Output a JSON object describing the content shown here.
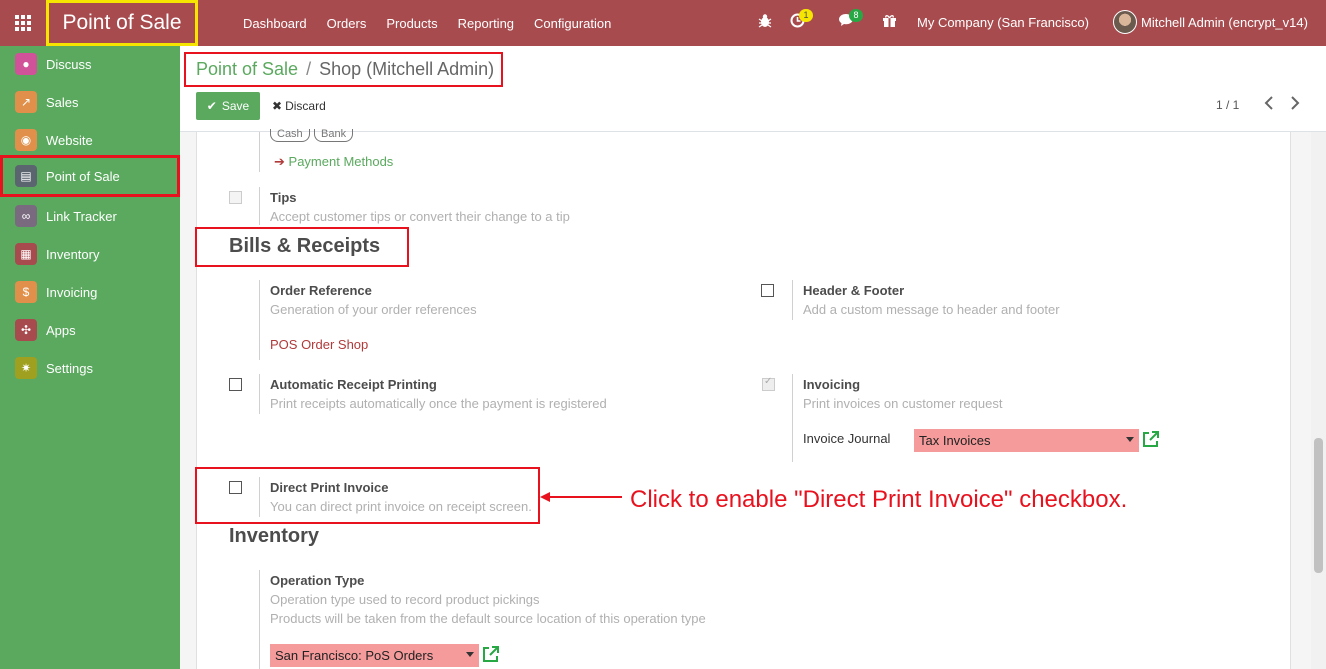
{
  "navbar": {
    "brand": "Point of Sale",
    "menu": [
      "Dashboard",
      "Orders",
      "Products",
      "Reporting",
      "Configuration"
    ],
    "activity_badge": "1",
    "messages_badge": "8",
    "company": "My Company (San Francisco)",
    "user": "Mitchell Admin (encrypt_v14)"
  },
  "sidebar": {
    "items": [
      {
        "label": "Discuss",
        "icon": "chat-bubble-icon",
        "color": "#d0539a"
      },
      {
        "label": "Sales",
        "icon": "chart-line-icon",
        "color": "#e0904a"
      },
      {
        "label": "Website",
        "icon": "globe-icon",
        "color": "#e0904a"
      },
      {
        "label": "Point of Sale",
        "icon": "store-icon",
        "color": "#5b6570"
      },
      {
        "label": "Link Tracker",
        "icon": "link-icon",
        "color": "#7a6a80"
      },
      {
        "label": "Inventory",
        "icon": "boxes-icon",
        "color": "#a74b4f"
      },
      {
        "label": "Invoicing",
        "icon": "invoice-icon",
        "color": "#e0904a"
      },
      {
        "label": "Apps",
        "icon": "puzzle-icon",
        "color": "#a74b4f"
      },
      {
        "label": "Settings",
        "icon": "gear-icon",
        "color": "#a0a020"
      }
    ]
  },
  "breadcrumb": {
    "parent": "Point of Sale",
    "separator": "/",
    "current": "Shop (Mitchell Admin)"
  },
  "toolbar": {
    "save_label": "Save",
    "discard_label": "Discard",
    "pager": "1 / 1"
  },
  "payments": {
    "tags": [
      "Cash",
      "Bank"
    ],
    "payment_methods_link": "Payment Methods"
  },
  "tips": {
    "title": "Tips",
    "description": "Accept customer tips or convert their change to a tip"
  },
  "bills_section": {
    "heading": "Bills & Receipts",
    "order_reference": {
      "title": "Order Reference",
      "description": "Generation of your order references",
      "value": "POS Order Shop"
    },
    "header_footer": {
      "title": "Header & Footer",
      "description": "Add a custom message to header and footer"
    },
    "auto_receipt": {
      "title": "Automatic Receipt Printing",
      "description": "Print receipts automatically once the payment is registered"
    },
    "invoicing": {
      "title": "Invoicing",
      "description": "Print invoices on customer request",
      "journal_label": "Invoice Journal",
      "journal_value": "Tax Invoices"
    },
    "direct_print": {
      "title": "Direct Print Invoice",
      "description": "You can direct print invoice on receipt screen."
    }
  },
  "annotation": "Click to enable \"Direct Print Invoice\" checkbox.",
  "inventory_section": {
    "heading": "Inventory",
    "operation_type": {
      "title": "Operation Type",
      "description": "Operation type used to record product pickings",
      "description2": "Products will be taken from the default source location of this operation type",
      "value": "San Francisco: PoS Orders"
    }
  },
  "colors": {
    "navbar": "#a74b4f",
    "sidebar": "#5aa95e",
    "highlight": "#e8121e",
    "brand_border": "#f5e500",
    "required_field": "#f59b9b"
  }
}
